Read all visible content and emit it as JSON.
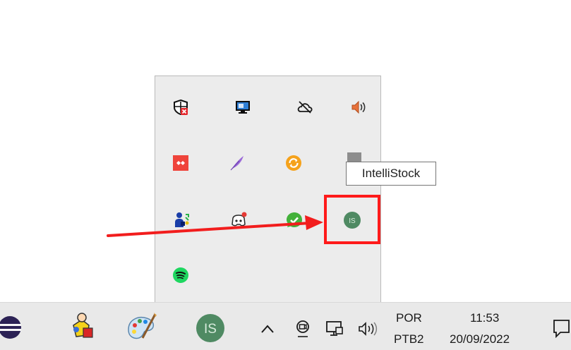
{
  "tooltip": {
    "text": "IntelliStock"
  },
  "flyout": {
    "icons": [
      "defender-warning-icon",
      "display-monitor-icon",
      "cloud-offline-icon",
      "volume-muted-icon",
      "anydesk-icon",
      "feather-icon",
      "sync-icon",
      "placeholder-app-icon",
      "bluetooth-people-icon",
      "discord-icon",
      "whatsapp-check-icon",
      "intellistock-icon",
      "spotify-icon"
    ],
    "intellistock_label": "IS"
  },
  "taskbar": {
    "intellistock_label": "IS",
    "language": {
      "line1": "POR",
      "line2": "PTB2"
    },
    "clock": {
      "time": "11:53",
      "date": "20/09/2022"
    }
  },
  "colors": {
    "highlight": "#ff1a1a",
    "intellistock": "#4f8a63",
    "spotify": "#1ed760"
  }
}
